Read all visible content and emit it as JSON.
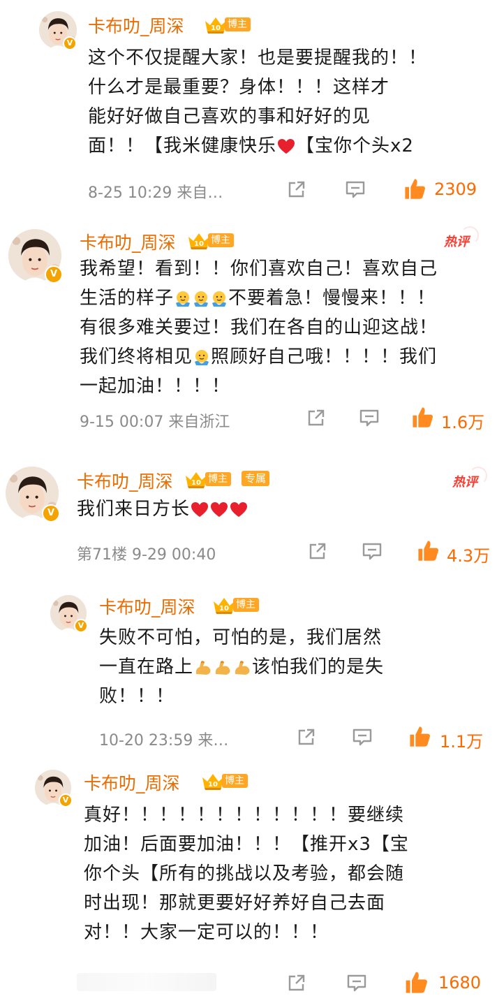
{
  "colors": {
    "username": "#ef6c00",
    "like": "#ff6a00",
    "hot": "#ff3b30",
    "badge": "#ffa724",
    "meta": "#8a8a8a"
  },
  "icons": {
    "share": "share-icon",
    "comment": "comment-icon",
    "like": "thumbs-up-icon",
    "verified": "verified-v-icon",
    "level": "crown-level-icon",
    "heart": "red-heart-emoji",
    "hug": "hug-emoji",
    "muscle": "flexed-biceps-emoji"
  },
  "comments": [
    {
      "username": "卡布叻_周深",
      "level": "10",
      "role_tag": "博主",
      "lines": [
        "这个不仅提醒大家！也是要提醒我的！！",
        "什么才是最重要？身体！！！这样才",
        "能好好做自己喜欢的事和好好的见",
        "面！！【我米健康快乐",
        "【宝你个头x2"
      ],
      "meta": "8-25 10:29  来自…",
      "likes": "2309"
    },
    {
      "username": "卡布叻_周深",
      "level": "10",
      "role_tag": "博主",
      "hot": "热评",
      "lines": [
        "我希望！看到！！你们喜欢自己！喜欢自己",
        "生活的样子",
        "不要着急！慢慢来！！！",
        "有很多难关要过！我们在各自的山迎这战！",
        "我们终将相见",
        "照顾好自己哦！！！！我们",
        "一起加油！！！！"
      ],
      "meta": "9-15 00:07  来自浙江",
      "likes": "1.6万"
    },
    {
      "username": "卡布叻_周深",
      "level": "10",
      "role_tag": "博主",
      "extra_tag": "专属",
      "hot": "热评",
      "lines": [
        "我们来日方长"
      ],
      "meta": "第71楼  9-29 00:40",
      "likes": "4.3万"
    },
    {
      "username": "卡布叻_周深",
      "level": "10",
      "role_tag": "博主",
      "lines": [
        "失败不可怕，可怕的是，我们居然",
        "一直在路上",
        "该怕我们的是失",
        "败！！！"
      ],
      "meta": "10-20 23:59  来…",
      "likes": "1.1万"
    },
    {
      "username": "卡布叻_周深",
      "level": "10",
      "role_tag": "博主",
      "lines": [
        "真好！！！！！！！！！！！！要继续",
        "加油！后面要加油！！！【推开x3【宝",
        "你个头【所有的挑战以及考验，都会随",
        "时出现！那就更要好好养好自己去面",
        "对！！大家一定可以的！！！"
      ],
      "meta": "",
      "likes": "1680"
    }
  ]
}
